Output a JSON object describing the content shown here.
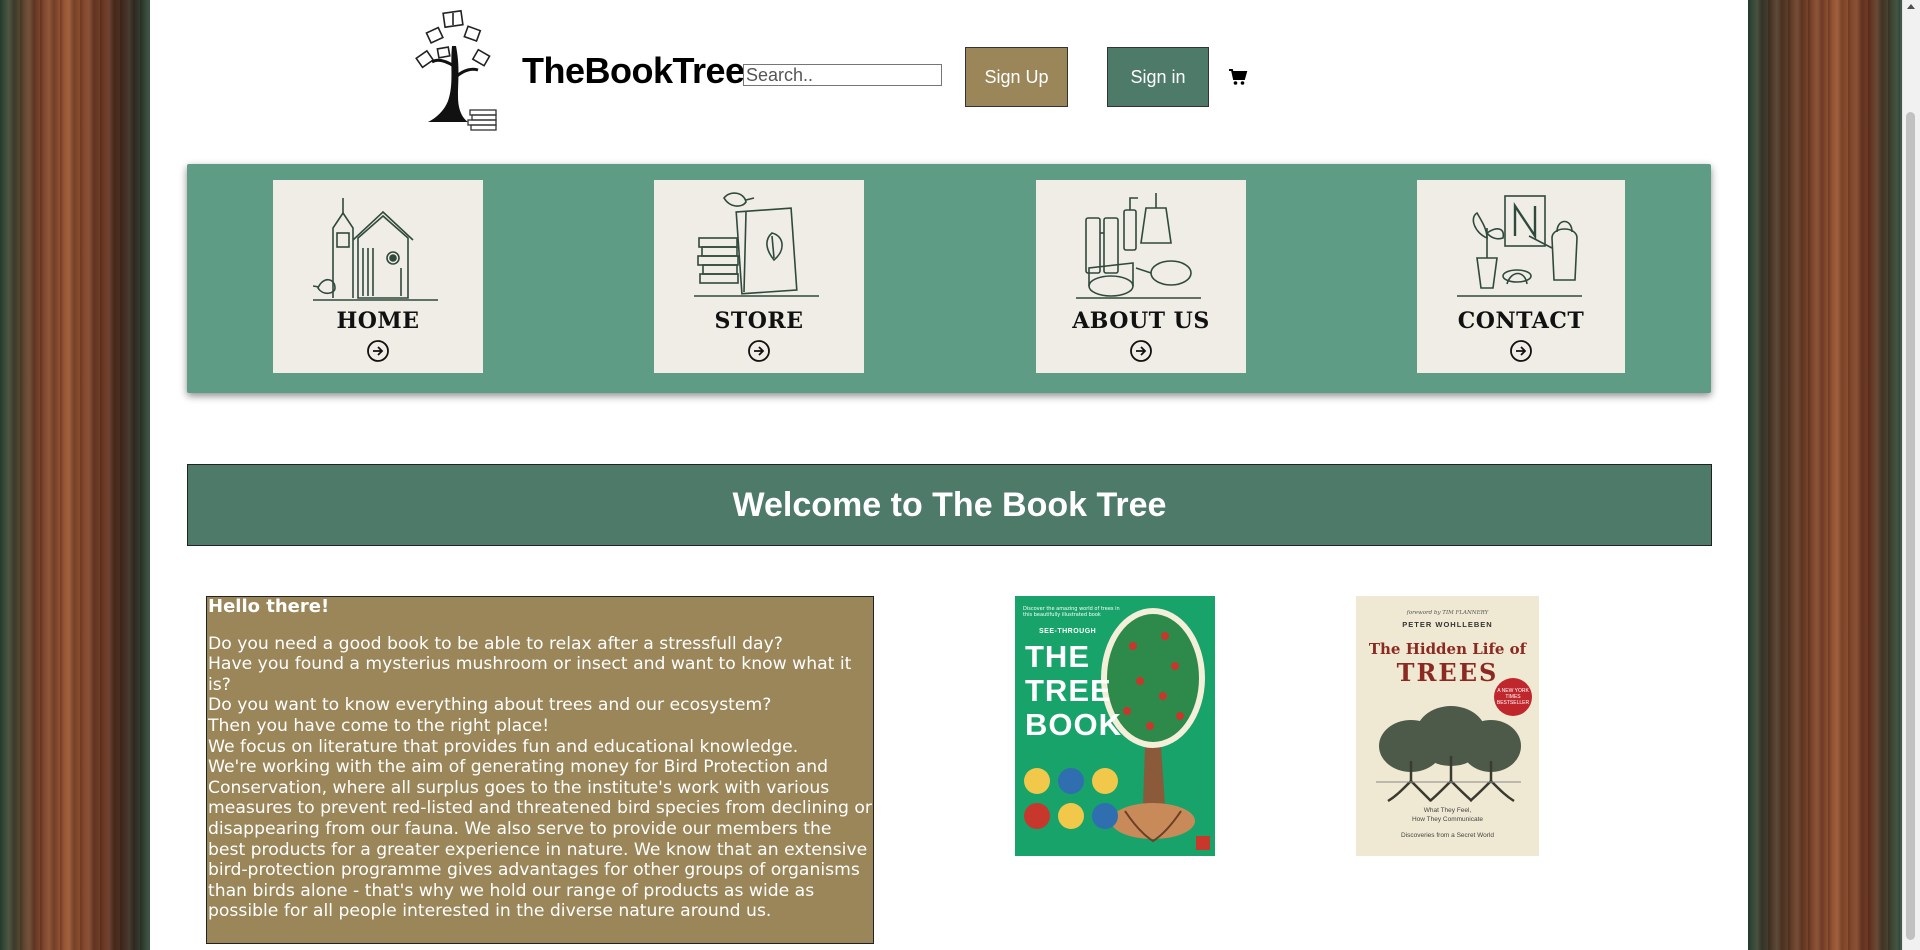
{
  "header": {
    "brand": "TheBookTree",
    "search_placeholder": "Search..",
    "signup_label": "Sign Up",
    "signin_label": "Sign in",
    "cart_icon": "shopping-cart-icon"
  },
  "nav": {
    "items": [
      {
        "label": "HOME",
        "icon": "birdhouse-illustration"
      },
      {
        "label": "STORE",
        "icon": "books-with-bird-illustration"
      },
      {
        "label": "ABOUT US",
        "icon": "binoculars-and-tools-illustration"
      },
      {
        "label": "CONTACT",
        "icon": "plant-and-watering-can-illustration"
      }
    ]
  },
  "welcome": {
    "title": "Welcome to The Book Tree"
  },
  "intro": {
    "heading": "Hello there!",
    "lines": [
      "Do you need a good book to be able to relax after a stressfull day?",
      "Have you found a mysterius mushroom or insect and want to know what it is?",
      "Do you want to know everything about trees and our ecosystem?",
      "Then you have come to the right place!",
      "We focus on literature that provides fun and educational knowledge.",
      "We're working with the aim of generating money for Bird Protection and Conservation, where all surplus goes to the institute's work with various measures to prevent red-listed and threatened bird species from declining or disappearing from our fauna. We also serve to provide our members the best products for a greater experience in nature. We know that an extensive bird-protection programme gives advantages for other groups of organisms than birds alone - that's why we hold our range of products as wide as possible for all people interested in the diverse nature around us."
    ]
  },
  "books": [
    {
      "cover_top": "Discover the amazing world of trees in this beautifully illustrated book",
      "series": "SEE-THROUGH",
      "title_lines": [
        "THE",
        "TREE",
        "BOOK"
      ]
    },
    {
      "foreword": "foreword by TIM FLANNERY",
      "author": "PETER WOHLLEBEN",
      "title_line1": "The Hidden Life of",
      "title_line2": "TREES",
      "badge": "A NEW YORK TIMES BESTSELLER",
      "subtitle_line1": "What They Feel,",
      "subtitle_line2": "How They Communicate",
      "discoveries": "Discoveries from a Secret World"
    }
  ],
  "colors": {
    "nav_green": "#5f9c86",
    "dark_green": "#4d7a69",
    "tan": "#9a8659"
  }
}
